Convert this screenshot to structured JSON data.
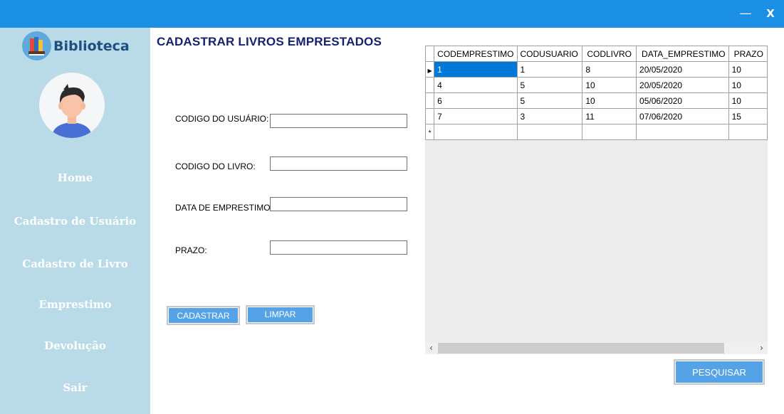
{
  "window": {
    "minimize_glyph": "—",
    "close_label": "X"
  },
  "sidebar": {
    "logo_text": "Biblioteca",
    "items": [
      {
        "label": "Home"
      },
      {
        "label": "Cadastro de Usuário"
      },
      {
        "label": "Cadastro de Livro"
      },
      {
        "label": "Emprestimo"
      },
      {
        "label": "Devolução"
      },
      {
        "label": "Sair"
      }
    ]
  },
  "form": {
    "title": "CADASTRAR LIVROS EMPRESTADOS",
    "codigo_usuario": {
      "label": "CODIGO DO USUÁRIO:",
      "value": ""
    },
    "codigo_livro": {
      "label": "CODIGO DO LIVRO:",
      "value": ""
    },
    "data_emprestimo": {
      "label": "DATA DE EMPRESTIMO:",
      "value": ""
    },
    "prazo": {
      "label": "PRAZO:",
      "value": ""
    },
    "cadastrar_label": "CADASTRAR",
    "limpar_label": "LIMPAR"
  },
  "grid": {
    "columns": [
      "CODEMPRESTIMO",
      "CODUSUARIO",
      "CODLIVRO",
      "DATA_EMPRESTIMO",
      "PRAZO"
    ],
    "rows": [
      [
        "1",
        "1",
        "8",
        "20/05/2020",
        "10"
      ],
      [
        "4",
        "5",
        "10",
        "20/05/2020",
        "10"
      ],
      [
        "6",
        "5",
        "10",
        "05/06/2020",
        "10"
      ],
      [
        "7",
        "3",
        "11",
        "07/06/2020",
        "15"
      ]
    ],
    "current_row_glyph": "▶",
    "new_row_glyph": "*"
  },
  "pesquisar_label": "PESQUISAR",
  "colors": {
    "titlebar": "#1a8fe3",
    "sidebar": "#b9dbe8",
    "button": "#55a3e6",
    "selection": "#0078d7"
  }
}
